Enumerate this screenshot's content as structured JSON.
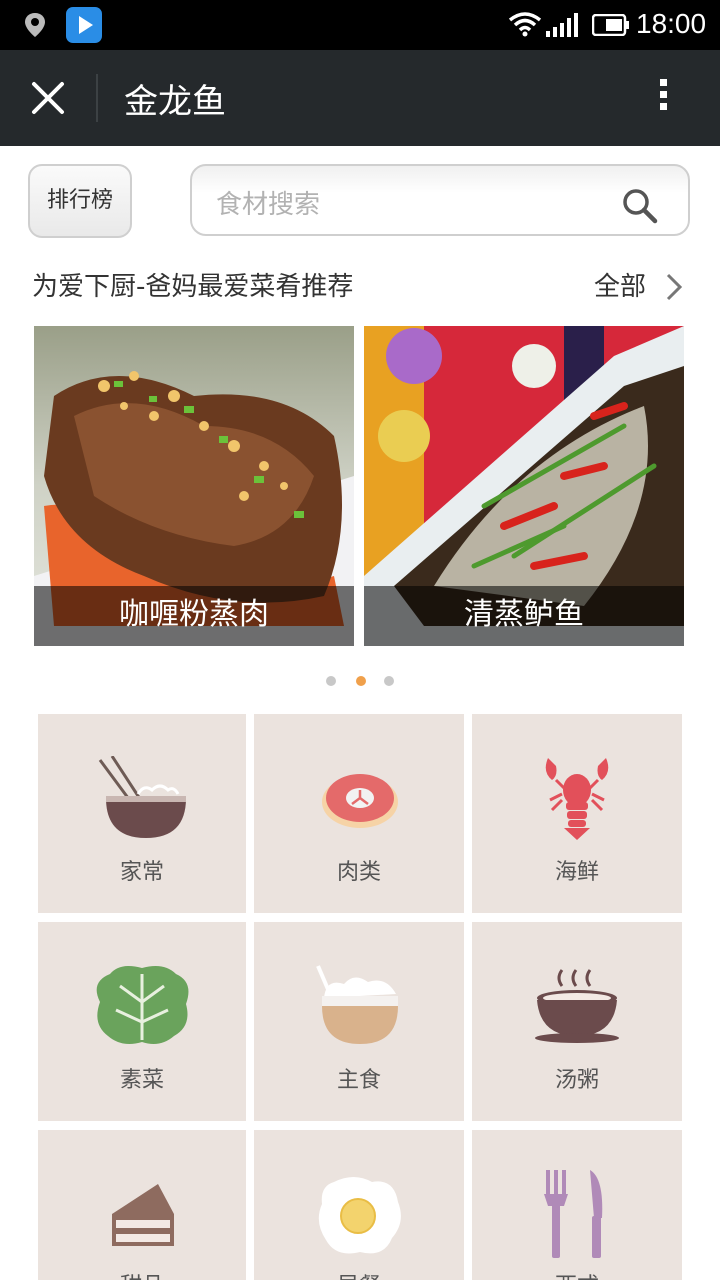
{
  "status_bar": {
    "time": "18:00"
  },
  "title_bar": {
    "title": "金龙鱼"
  },
  "search": {
    "rank_label": "排行榜",
    "placeholder": "食材搜索"
  },
  "section": {
    "title": "为爱下厨-爸妈最爱菜肴推荐",
    "all_label": "全部"
  },
  "carousel": {
    "items": [
      {
        "caption": "咖喱粉蒸肉"
      },
      {
        "caption": "清蒸鲈鱼"
      }
    ],
    "page_count": 3,
    "active_index": 1
  },
  "categories": [
    {
      "label": "家常",
      "icon": "rice-bowl-icon"
    },
    {
      "label": "肉类",
      "icon": "steak-icon"
    },
    {
      "label": "海鲜",
      "icon": "lobster-icon"
    },
    {
      "label": "素菜",
      "icon": "cabbage-icon"
    },
    {
      "label": "主食",
      "icon": "rice-icon"
    },
    {
      "label": "汤粥",
      "icon": "soup-icon"
    },
    {
      "label": "甜品",
      "icon": "cake-icon"
    },
    {
      "label": "早餐",
      "icon": "egg-icon"
    },
    {
      "label": "西式",
      "icon": "fork-knife-icon"
    }
  ],
  "colors": {
    "title_bar": "#25292c",
    "tile_bg": "#ebe3de",
    "dot_active": "#f0a04b",
    "dot_inactive": "#c8c8c8"
  }
}
